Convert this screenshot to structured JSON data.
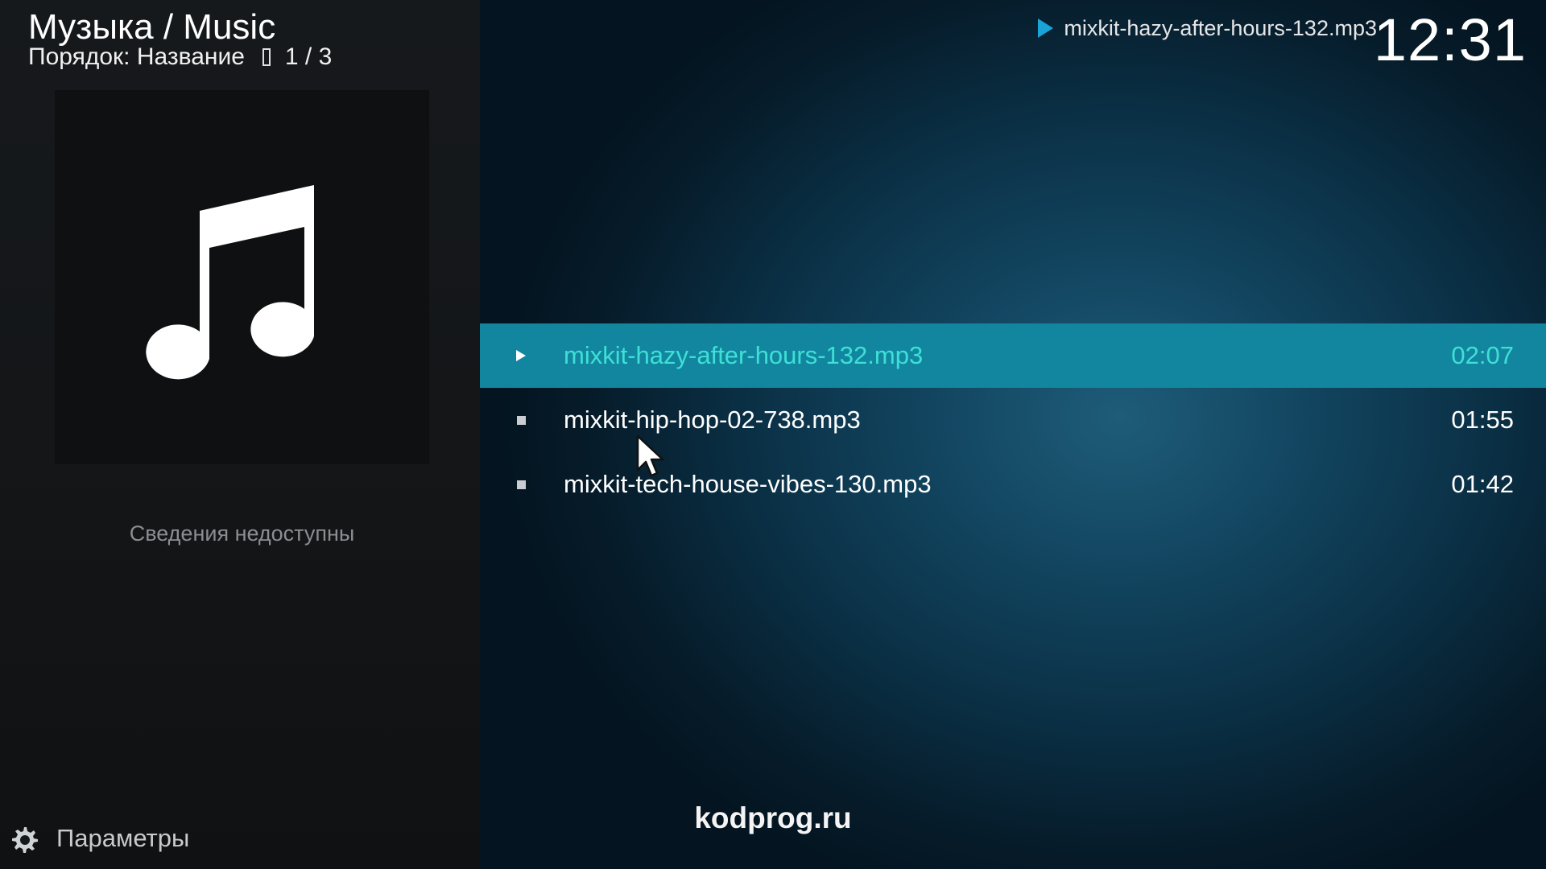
{
  "header": {
    "title": "Музыка / Music",
    "sort_label": "Порядок: Название",
    "position": "1 / 3"
  },
  "now_playing": {
    "icon": "play-icon",
    "title": "mixkit-hazy-after-hours-132.mp3"
  },
  "clock": "12:31",
  "info_panel": {
    "art_icon": "music-note-icon",
    "no_info": "Сведения недоступны"
  },
  "list": {
    "parent_label": "..",
    "items": [
      {
        "name": "mixkit-hazy-after-hours-132.mp3",
        "duration": "02:07",
        "state": "playing"
      },
      {
        "name": "mixkit-hip-hop-02-738.mp3",
        "duration": "01:55",
        "state": "stopped"
      },
      {
        "name": "mixkit-tech-house-vibes-130.mp3",
        "duration": "01:42",
        "state": "stopped"
      }
    ]
  },
  "footer": {
    "settings_label": "Параметры",
    "settings_icon": "gear-icon",
    "watermark": "kodprog.ru"
  },
  "colors": {
    "accent": "#12869f",
    "selected_text": "#3ee0d6",
    "left_panel": "#15181b",
    "play_icon": "#1aa3d6"
  }
}
